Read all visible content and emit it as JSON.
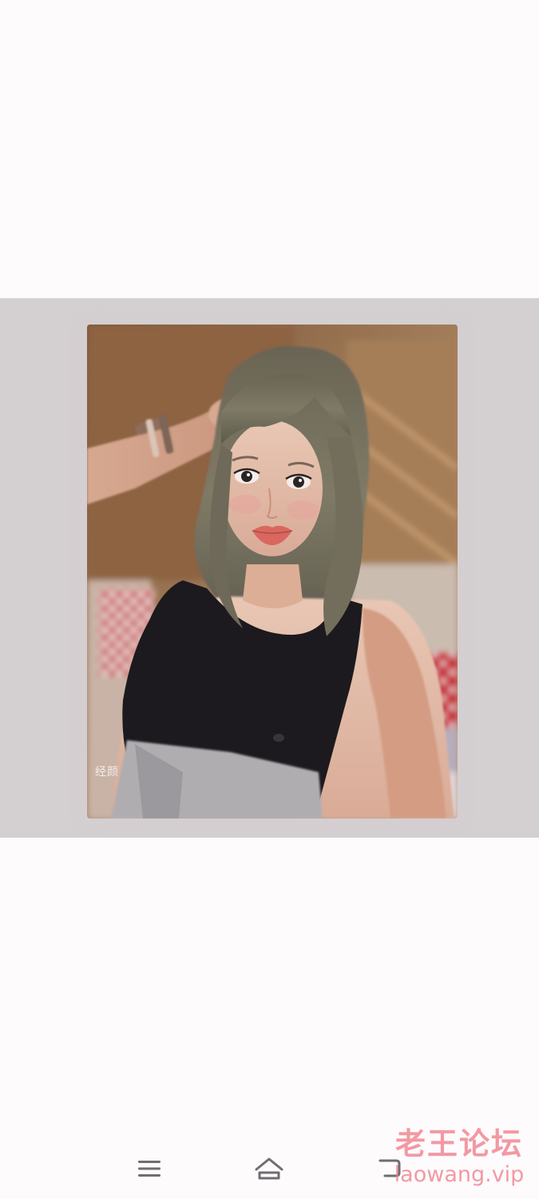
{
  "photo": {
    "subject": "selfie-portrait",
    "watermark_text": "经颜",
    "colors": {
      "viewer_background": "#d4cfd1",
      "page_background": "#fdfbfc"
    }
  },
  "navigation_bar": {
    "buttons": [
      {
        "name": "menu",
        "icon": "menu-icon"
      },
      {
        "name": "home",
        "icon": "home-icon"
      },
      {
        "name": "back",
        "icon": "back-icon"
      }
    ]
  },
  "site_watermark": {
    "chinese": "老王论坛",
    "url": "laowang.vip",
    "color": "#ee7e8a"
  }
}
